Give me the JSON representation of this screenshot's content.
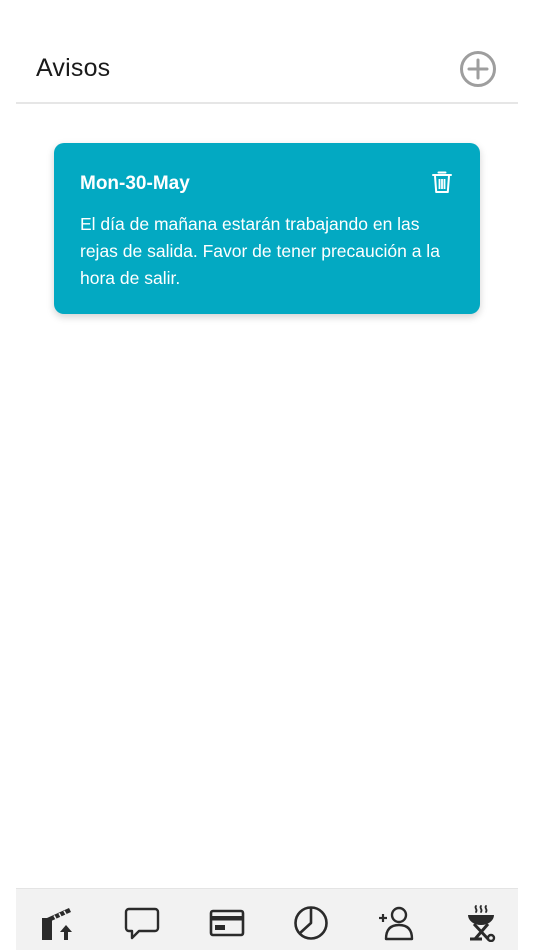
{
  "header": {
    "title": "Avisos",
    "add_icon": "plus-circle-icon"
  },
  "notices": [
    {
      "date": "Mon-30-May",
      "body": "El día de mañana estarán trabajando en las rejas de salida. Favor de tener precaución a la hora de salir.",
      "delete_icon": "trash-icon"
    }
  ],
  "bottom_nav": {
    "items": [
      {
        "icon": "barrier-gate-icon"
      },
      {
        "icon": "chat-bubble-icon"
      },
      {
        "icon": "credit-card-icon"
      },
      {
        "icon": "pie-chart-icon"
      },
      {
        "icon": "add-user-icon"
      },
      {
        "icon": "grill-icon"
      }
    ]
  },
  "colors": {
    "card_background": "#03a9c2",
    "nav_background": "#f2f2f2",
    "icon_gray": "#9e9e9e",
    "icon_dark": "#2b2b2b"
  }
}
